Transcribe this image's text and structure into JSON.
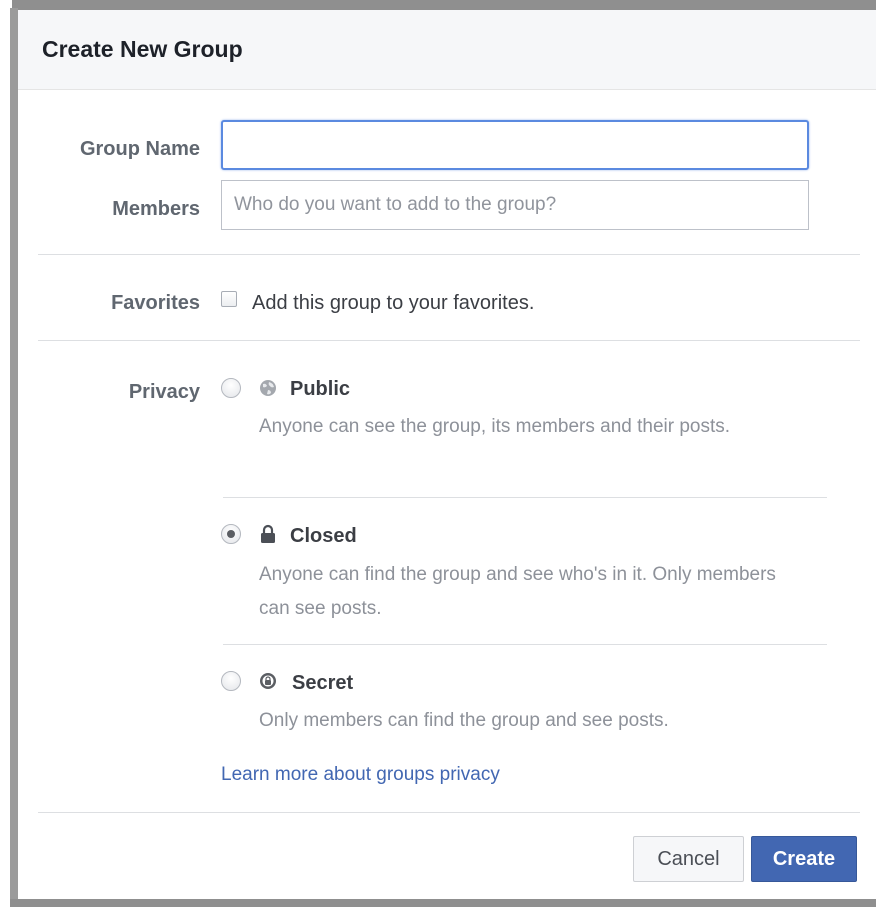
{
  "dialog": {
    "title": "Create New Group"
  },
  "group_name": {
    "label": "Group Name",
    "value": ""
  },
  "members": {
    "label": "Members",
    "placeholder": "Who do you want to add to the group?"
  },
  "favorites": {
    "label": "Favorites",
    "checkbox_text": "Add this group to your favorites.",
    "checked": false
  },
  "privacy": {
    "label": "Privacy",
    "options": [
      {
        "title": "Public",
        "icon": "globe-icon",
        "description": "Anyone can see the group, its members and their posts.",
        "selected": false
      },
      {
        "title": "Closed",
        "icon": "lock-icon",
        "description": "Anyone can find the group and see who's in it. Only members can see posts.",
        "selected": true
      },
      {
        "title": "Secret",
        "icon": "secret-lock-icon",
        "description": "Only members can find the group and see posts.",
        "selected": false
      }
    ],
    "learn_more": "Learn more about groups privacy"
  },
  "footer": {
    "cancel_label": "Cancel",
    "create_label": "Create"
  },
  "colors": {
    "accent": "#4267b2",
    "link": "#4267b2",
    "focus_border": "#5b8ae0"
  }
}
